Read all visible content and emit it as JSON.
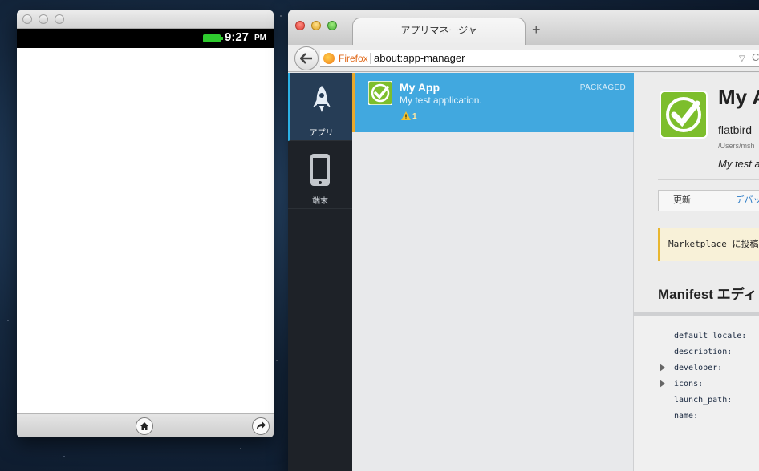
{
  "simulator": {
    "time": "9:27",
    "ampm": "PM",
    "icons": {
      "home": "home-icon",
      "rotate": "rotate-icon"
    }
  },
  "browser": {
    "tab_title": "アプリマネージャ",
    "new_tab_symbol": "+",
    "url_identity": "Firefox",
    "url": "about:app-manager",
    "url_dropdown_symbol": "▽",
    "url_end_symbol": "C"
  },
  "sidebar": {
    "items": [
      {
        "label": "アプリ",
        "icon": "rocket-icon",
        "active": true
      },
      {
        "label": "端末",
        "icon": "phone-device-icon",
        "active": false
      }
    ]
  },
  "app_list": {
    "items": [
      {
        "name": "My App",
        "description": "My test application.",
        "type": "PACKAGED",
        "warnings": "1",
        "icon": "app-checkmark-icon"
      }
    ]
  },
  "detail": {
    "title": "My A",
    "developer": "flatbird",
    "path": "/Users/msh",
    "description": "My test a",
    "update_label": "更新",
    "debug_label": "デバッグ",
    "notice": "Marketplace に投稿",
    "manifest_heading": "Manifest エディ",
    "manifest_rows": [
      {
        "key": "default_locale:",
        "expandable": false
      },
      {
        "key": "description:",
        "expandable": false
      },
      {
        "key": "developer:",
        "expandable": true
      },
      {
        "key": "icons:",
        "expandable": true
      },
      {
        "key": "launch_path:",
        "expandable": false
      },
      {
        "key": "name:",
        "expandable": false
      }
    ]
  },
  "colors": {
    "selected_row": "#41a8df",
    "accent_bar": "#e8a82c",
    "sidebar_bg": "#1e2228",
    "sidebar_active": "#263d56"
  }
}
